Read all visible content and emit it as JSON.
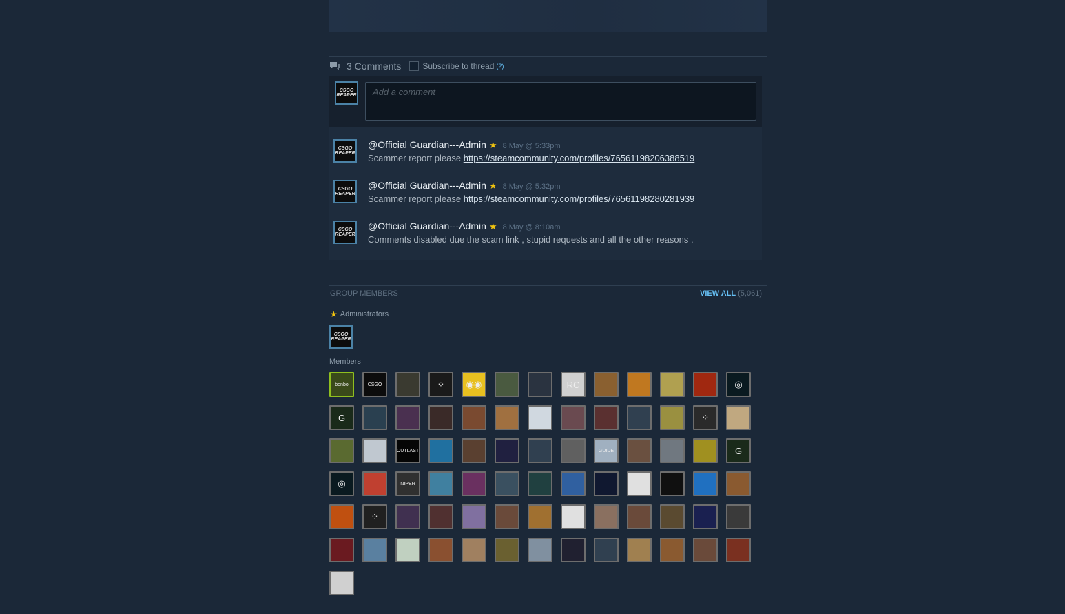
{
  "comments": {
    "count_label": "3 Comments",
    "subscribe_label": "Subscribe to thread",
    "help_label": "(?)",
    "input_placeholder": "Add a comment",
    "current_user_avatar": "CSGO REAPER",
    "items": [
      {
        "author": "@Official Guardian---Admin",
        "timestamp": "8 May @ 5:33pm",
        "text": "Scammer report please ",
        "link": "https://steamcommunity.com/profiles/76561198206388519",
        "avatar": "CSGO REAPER"
      },
      {
        "author": "@Official Guardian---Admin",
        "timestamp": "8 May @ 5:32pm",
        "text": "Scammer report please ",
        "link": "https://steamcommunity.com/profiles/76561198280281939",
        "avatar": "CSGO REAPER"
      },
      {
        "author": "@Official Guardian---Admin",
        "timestamp": "8 May @ 8:10am",
        "text": "Comments disabled due the scam link , stupid requests and all the other reasons .",
        "link": "",
        "avatar": "CSGO REAPER"
      }
    ]
  },
  "group_members": {
    "title": "GROUP MEMBERS",
    "view_all": "VIEW ALL",
    "count": "(5,061)",
    "admins_label": "Administrators",
    "admin_avatar": "CSGO REAPER",
    "members_label": "Members",
    "member_avatars": [
      {
        "bg": "#3a4a1a",
        "border": "#8fbf1f",
        "glyph": "bonbo"
      },
      {
        "bg": "#0c0c0c",
        "border": "#6d6d6d",
        "glyph": "CSGO"
      },
      {
        "bg": "#3a3a30",
        "border": "#6d6d6d",
        "glyph": ""
      },
      {
        "bg": "#1a1a1a",
        "border": "#6d6d6d",
        "glyph": "⁘"
      },
      {
        "bg": "#e8c020",
        "border": "#6d6d6d",
        "glyph": "◉◉"
      },
      {
        "bg": "#4a5a40",
        "border": "#6d6d6d",
        "glyph": ""
      },
      {
        "bg": "#2a3340",
        "border": "#6d6d6d",
        "glyph": ""
      },
      {
        "bg": "#d0d0d0",
        "border": "#6d6d6d",
        "glyph": "RC"
      },
      {
        "bg": "#8a6030",
        "border": "#6d6d6d",
        "glyph": ""
      },
      {
        "bg": "#c07820",
        "border": "#6d6d6d",
        "glyph": ""
      },
      {
        "bg": "#b0a050",
        "border": "#6d6d6d",
        "glyph": ""
      },
      {
        "bg": "#a02810",
        "border": "#6d6d6d",
        "glyph": ""
      },
      {
        "bg": "#0a1a20",
        "border": "#6d6d6d",
        "glyph": "◎"
      },
      {
        "bg": "#1a2a1a",
        "border": "#6d6d6d",
        "glyph": "G"
      },
      {
        "bg": "#2a4050",
        "border": "#6d6d6d",
        "glyph": ""
      },
      {
        "bg": "#4a3050",
        "border": "#6d6d6d",
        "glyph": ""
      },
      {
        "bg": "#3a2a28",
        "border": "#6d6d6d",
        "glyph": ""
      },
      {
        "bg": "#7a4a30",
        "border": "#6d6d6d",
        "glyph": ""
      },
      {
        "bg": "#a07040",
        "border": "#6d6d6d",
        "glyph": ""
      },
      {
        "bg": "#d0d8e0",
        "border": "#6d6d6d",
        "glyph": ""
      },
      {
        "bg": "#6a4a50",
        "border": "#6d6d6d",
        "glyph": ""
      },
      {
        "bg": "#5a3030",
        "border": "#6d6d6d",
        "glyph": ""
      },
      {
        "bg": "#304050",
        "border": "#6d6d6d",
        "glyph": ""
      },
      {
        "bg": "#9a9040",
        "border": "#6d6d6d",
        "glyph": ""
      },
      {
        "bg": "#2a2a2a",
        "border": "#6d6d6d",
        "glyph": "⁘"
      },
      {
        "bg": "#c0a880",
        "border": "#6d6d6d",
        "glyph": ""
      },
      {
        "bg": "#5a6a30",
        "border": "#6d6d6d",
        "glyph": ""
      },
      {
        "bg": "#c0c8d0",
        "border": "#6d6d6d",
        "glyph": ""
      },
      {
        "bg": "#050505",
        "border": "#6d6d6d",
        "glyph": "OUTLAST"
      },
      {
        "bg": "#2070a0",
        "border": "#6d6d6d",
        "glyph": ""
      },
      {
        "bg": "#5a4030",
        "border": "#6d6d6d",
        "glyph": ""
      },
      {
        "bg": "#202040",
        "border": "#6d6d6d",
        "glyph": ""
      },
      {
        "bg": "#304050",
        "border": "#6d6d6d",
        "glyph": ""
      },
      {
        "bg": "#606060",
        "border": "#6d6d6d",
        "glyph": ""
      },
      {
        "bg": "#a0b0c0",
        "border": "#6d6d6d",
        "glyph": "GUIDE"
      },
      {
        "bg": "#6a5040",
        "border": "#6d6d6d",
        "glyph": ""
      },
      {
        "bg": "#707880",
        "border": "#6d6d6d",
        "glyph": ""
      },
      {
        "bg": "#a09020",
        "border": "#6d6d6d",
        "glyph": ""
      },
      {
        "bg": "#1a2a1a",
        "border": "#6d6d6d",
        "glyph": "G"
      },
      {
        "bg": "#0a1a20",
        "border": "#6d6d6d",
        "glyph": "◎"
      },
      {
        "bg": "#c04030",
        "border": "#6d6d6d",
        "glyph": ""
      },
      {
        "bg": "#303030",
        "border": "#6d6d6d",
        "glyph": "NIPER"
      },
      {
        "bg": "#4080a0",
        "border": "#6d6d6d",
        "glyph": ""
      },
      {
        "bg": "#6a3060",
        "border": "#6d6d6d",
        "glyph": ""
      },
      {
        "bg": "#3a5060",
        "border": "#6d6d6d",
        "glyph": ""
      },
      {
        "bg": "#204040",
        "border": "#6d6d6d",
        "glyph": ""
      },
      {
        "bg": "#3060a0",
        "border": "#6d6d6d",
        "glyph": ""
      },
      {
        "bg": "#101830",
        "border": "#6d6d6d",
        "glyph": ""
      },
      {
        "bg": "#e0e0e0",
        "border": "#6d6d6d",
        "glyph": ""
      },
      {
        "bg": "#101010",
        "border": "#6d6d6d",
        "glyph": ""
      },
      {
        "bg": "#2070c0",
        "border": "#6d6d6d",
        "glyph": ""
      },
      {
        "bg": "#8a5a30",
        "border": "#6d6d6d",
        "glyph": ""
      },
      {
        "bg": "#c05010",
        "border": "#6d6d6d",
        "glyph": ""
      },
      {
        "bg": "#202020",
        "border": "#6d6d6d",
        "glyph": "⁘"
      },
      {
        "bg": "#403050",
        "border": "#6d6d6d",
        "glyph": ""
      },
      {
        "bg": "#503030",
        "border": "#6d6d6d",
        "glyph": ""
      },
      {
        "bg": "#8070a0",
        "border": "#6d6d6d",
        "glyph": ""
      },
      {
        "bg": "#6a4a3a",
        "border": "#6d6d6d",
        "glyph": ""
      },
      {
        "bg": "#a07030",
        "border": "#6d6d6d",
        "glyph": ""
      },
      {
        "bg": "#e0e0e0",
        "border": "#6d6d6d",
        "glyph": ""
      },
      {
        "bg": "#8a7060",
        "border": "#6d6d6d",
        "glyph": ""
      },
      {
        "bg": "#6a4a3a",
        "border": "#6d6d6d",
        "glyph": ""
      },
      {
        "bg": "#5a4a30",
        "border": "#6d6d6d",
        "glyph": ""
      },
      {
        "bg": "#1a2050",
        "border": "#6d6d6d",
        "glyph": ""
      },
      {
        "bg": "#3a3a3a",
        "border": "#6d6d6d",
        "glyph": ""
      },
      {
        "bg": "#6a1a20",
        "border": "#6d6d6d",
        "glyph": ""
      },
      {
        "bg": "#5a80a0",
        "border": "#6d6d6d",
        "glyph": ""
      },
      {
        "bg": "#c0d0c0",
        "border": "#6d6d6d",
        "glyph": ""
      },
      {
        "bg": "#8a5030",
        "border": "#6d6d6d",
        "glyph": ""
      },
      {
        "bg": "#a08060",
        "border": "#6d6d6d",
        "glyph": ""
      },
      {
        "bg": "#6a6030",
        "border": "#6d6d6d",
        "glyph": ""
      },
      {
        "bg": "#8090a0",
        "border": "#6d6d6d",
        "glyph": ""
      },
      {
        "bg": "#202030",
        "border": "#6d6d6d",
        "glyph": ""
      },
      {
        "bg": "#304050",
        "border": "#6d6d6d",
        "glyph": ""
      },
      {
        "bg": "#a08050",
        "border": "#6d6d6d",
        "glyph": ""
      },
      {
        "bg": "#8a5a30",
        "border": "#6d6d6d",
        "glyph": ""
      },
      {
        "bg": "#6a4a3a",
        "border": "#6d6d6d",
        "glyph": ""
      },
      {
        "bg": "#7a3020",
        "border": "#6d6d6d",
        "glyph": ""
      },
      {
        "bg": "#d0d0d0",
        "border": "#6d6d6d",
        "glyph": ""
      }
    ]
  }
}
